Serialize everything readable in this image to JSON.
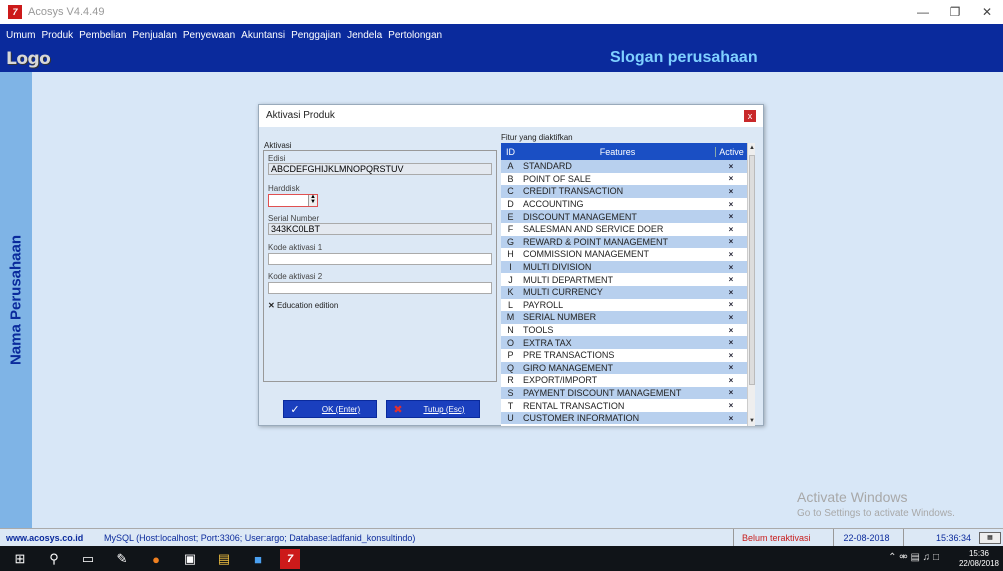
{
  "window": {
    "title": "Acosys V4.4.49",
    "app_icon_glyph": "7"
  },
  "menu": [
    "Umum",
    "Produk",
    "Pembelian",
    "Penjualan",
    "Penyewaan",
    "Akuntansi",
    "Penggajian",
    "Jendela",
    "Pertolongan"
  ],
  "header": {
    "logo": "Logo",
    "slogan": "Slogan perusahaan"
  },
  "sidebar": {
    "company_name": "Nama Perusahaan"
  },
  "dialog": {
    "title": "Aktivasi Produk",
    "close_glyph": "x",
    "aktivasi_legend": "Aktivasi",
    "edisi_label": "Edisi",
    "edisi_value": "ABCDEFGHIJKLMNOPQRSTUV",
    "harddisk_label": "Harddisk",
    "serial_label": "Serial Number",
    "serial_value": "343KC0LBT",
    "kode1_label": "Kode aktivasi 1",
    "kode2_label": "Kode aktivasi 2",
    "education_label": "Education edition",
    "education_checked": true,
    "ok_label": "OK (Enter)",
    "cancel_label": "Tutup (Esc)",
    "features_caption": "Fitur yang diaktifkan",
    "table_headers": {
      "id": "ID",
      "features": "Features",
      "active": "Active"
    },
    "features": [
      {
        "id": "A",
        "name": "STANDARD",
        "active": "×"
      },
      {
        "id": "B",
        "name": "POINT OF SALE",
        "active": "×"
      },
      {
        "id": "C",
        "name": "CREDIT TRANSACTION",
        "active": "×"
      },
      {
        "id": "D",
        "name": "ACCOUNTING",
        "active": "×"
      },
      {
        "id": "E",
        "name": "DISCOUNT MANAGEMENT",
        "active": "×"
      },
      {
        "id": "F",
        "name": "SALESMAN AND SERVICE DOER",
        "active": "×"
      },
      {
        "id": "G",
        "name": "REWARD & POINT MANAGEMENT",
        "active": "×"
      },
      {
        "id": "H",
        "name": "COMMISSION MANAGEMENT",
        "active": "×"
      },
      {
        "id": "I",
        "name": "MULTI DIVISION",
        "active": "×"
      },
      {
        "id": "J",
        "name": "MULTI DEPARTMENT",
        "active": "×"
      },
      {
        "id": "K",
        "name": "MULTI CURRENCY",
        "active": "×"
      },
      {
        "id": "L",
        "name": "PAYROLL",
        "active": "×"
      },
      {
        "id": "M",
        "name": "SERIAL NUMBER",
        "active": "×"
      },
      {
        "id": "N",
        "name": "TOOLS",
        "active": "×"
      },
      {
        "id": "O",
        "name": "EXTRA TAX",
        "active": "×"
      },
      {
        "id": "P",
        "name": "PRE TRANSACTIONS",
        "active": "×"
      },
      {
        "id": "Q",
        "name": "GIRO MANAGEMENT",
        "active": "×"
      },
      {
        "id": "R",
        "name": "EXPORT/IMPORT",
        "active": "×"
      },
      {
        "id": "S",
        "name": "PAYMENT DISCOUNT MANAGEMENT",
        "active": "×"
      },
      {
        "id": "T",
        "name": "RENTAL TRANSACTION",
        "active": "×"
      },
      {
        "id": "U",
        "name": "CUSTOMER INFORMATION",
        "active": "×"
      }
    ]
  },
  "watermark": {
    "title": "Activate Windows",
    "subtitle": "Go to Settings to activate Windows."
  },
  "statusbar": {
    "website": "www.acosys.co.id",
    "db_info": "MySQL (Host:localhost; Port:3306; User:argo; Database:ladfanid_konsultindo)",
    "license": "Belum teraktivasi",
    "date": "22-08-2018",
    "time": "15:36:34"
  },
  "taskbar": {
    "clock_time": "15:36",
    "clock_date": "22/08/2018"
  },
  "colors": {
    "menu_bg": "#0a2a9c",
    "slogan": "#7fd0ff",
    "desktop": "#d8e7f7",
    "table_header": "#1a4fc4",
    "row_alt": "#b8d0ee",
    "license_text": "#c82020"
  }
}
